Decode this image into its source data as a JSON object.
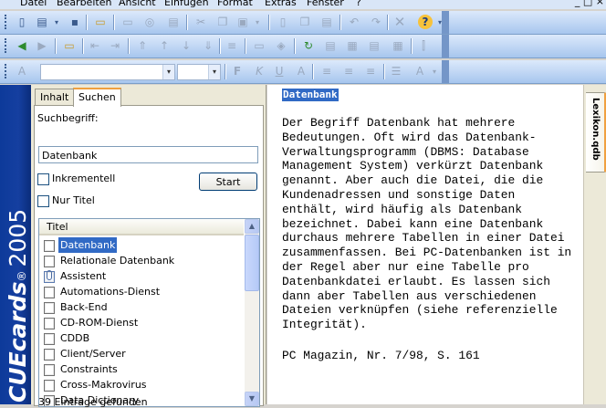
{
  "menu": {
    "items": [
      "Datei",
      "Bearbeiten",
      "Ansicht",
      "Einfügen",
      "Format",
      "Extras",
      "Fenster",
      "?"
    ],
    "window_controls": "_ □ ×"
  },
  "toolbar": {
    "font_combo_value": "",
    "size_combo_value": ""
  },
  "brand": {
    "name": "CUEcards",
    "reg": "®",
    "year": "2005"
  },
  "tabs": [
    {
      "label": "Inhalt"
    },
    {
      "label": "Suchen"
    }
  ],
  "search": {
    "label": "Suchbegriff:",
    "value": "Datenbank",
    "incremental_label": "Inkrementell",
    "title_only_label": "Nur Titel",
    "start_label": "Start"
  },
  "results": {
    "column_header": "Titel",
    "items": [
      {
        "label": "Datenbank",
        "icon": "page-icon"
      },
      {
        "label": "Relationale Datenbank",
        "icon": "page-icon"
      },
      {
        "label": "Assistent",
        "icon": "attachment-icon"
      },
      {
        "label": "Automations-Dienst",
        "icon": "page-icon"
      },
      {
        "label": "Back-End",
        "icon": "page-icon"
      },
      {
        "label": "CD-ROM-Dienst",
        "icon": "page-icon"
      },
      {
        "label": "CDDB",
        "icon": "page-icon"
      },
      {
        "label": "Client/Server",
        "icon": "page-icon"
      },
      {
        "label": "Constraints",
        "icon": "page-icon"
      },
      {
        "label": "Cross-Makrovirus",
        "icon": "page-icon"
      },
      {
        "label": "Data Dictionary",
        "icon": "page-icon"
      }
    ],
    "footer": "39 Einträge gefunden"
  },
  "article": {
    "title": "Datenbank",
    "body": "Der Begriff Datenbank hat mehrere\nBedeutungen. Oft wird das Datenbank-\nVerwaltungsprogramm (DBMS: Database\nManagement System) verkürzt Datenbank\ngenannt. Aber auch die Datei, die die\nKundenadressen und sonstige Daten\nenthält, wird häufig als Datenbank\nbezeichnet. Dabei kann eine Datenbank\ndurchaus mehrere Tabellen in einer Datei\nzusammenfassen. Bei PC-Datenbanken ist in\nder Regel aber nur eine Tabelle pro\nDatenbankdatei erlaubt. Es lassen sich\ndann aber Tabellen aus verschiedenen\nDateien verknüpfen (siehe referenzielle\nIntegrität).",
    "citation": "PC Magazin, Nr. 7/98, S. 161"
  },
  "side_tab": {
    "label": "Lexikon.qdb"
  },
  "colors": {
    "selection": "#316ac5",
    "sidebar_blue": "#153fa0",
    "tab_accent": "#f0a040"
  }
}
